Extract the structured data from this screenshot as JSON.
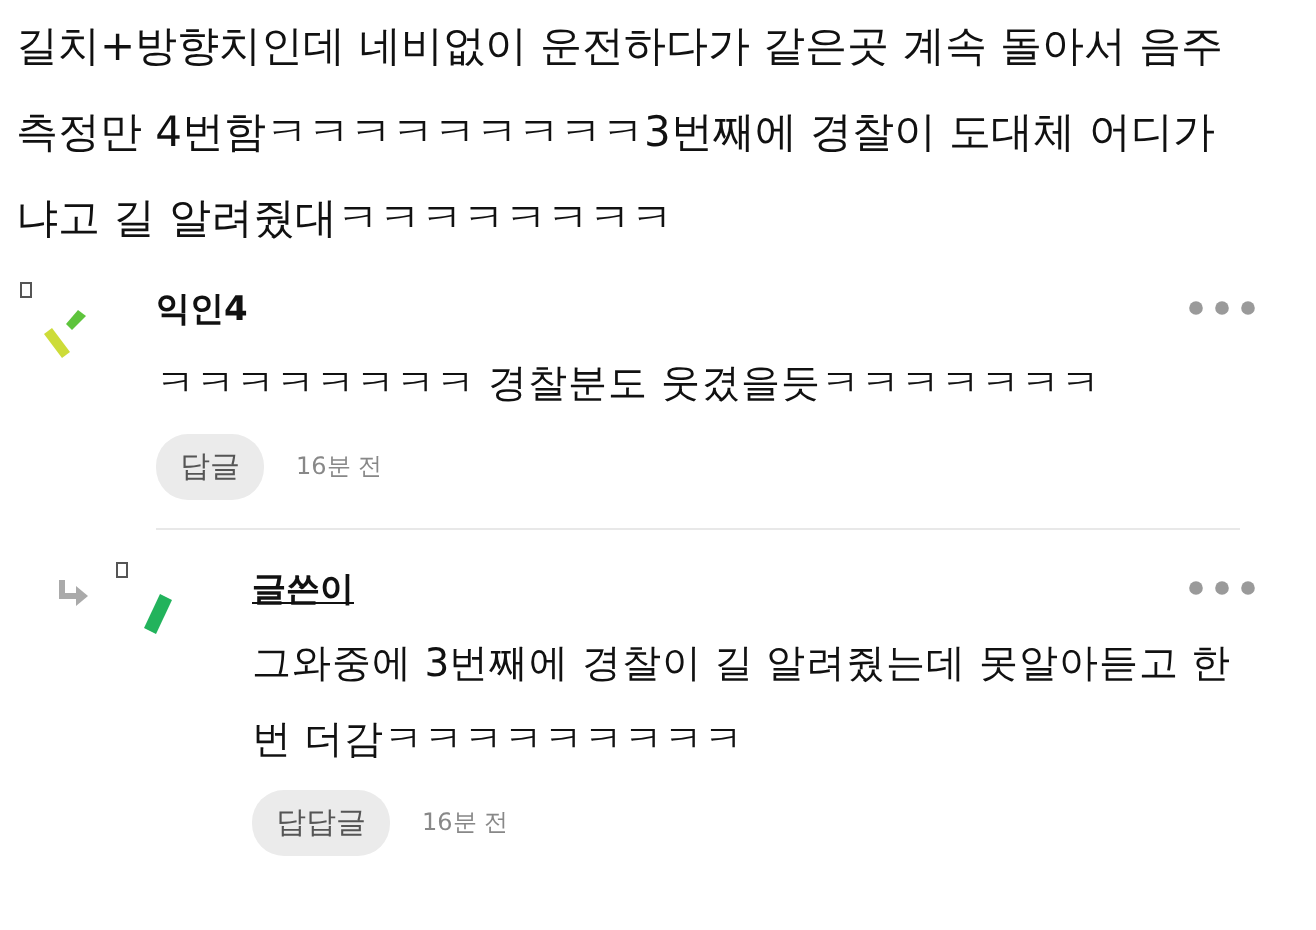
{
  "post": {
    "body": "길치+방향치인데 네비없이 운전하다가 같은곳 계속 돌아서 음주측정만 4번함ㅋㅋㅋㅋㅋㅋㅋㅋㅋ3번째에 경찰이 도대체 어디가냐고 길 알려줬대ㅋㅋㅋㅋㅋㅋㅋㅋ"
  },
  "comments": [
    {
      "kind": "comment",
      "author": "익인4",
      "author_is_op": false,
      "text": "ㅋㅋㅋㅋㅋㅋㅋㅋ 경찰분도 웃겼을듯ㅋㅋㅋㅋㅋㅋㅋ",
      "reply_button": "답글",
      "time": "16분 전"
    },
    {
      "kind": "reply",
      "author": "글쓴이",
      "author_is_op": true,
      "text": "그와중에 3번째에 경찰이 길 알려줬는데 못알아듣고 한번 더감ㅋㅋㅋㅋㅋㅋㅋㅋㅋ",
      "reply_button": "답답글",
      "time": "16분 전"
    }
  ]
}
